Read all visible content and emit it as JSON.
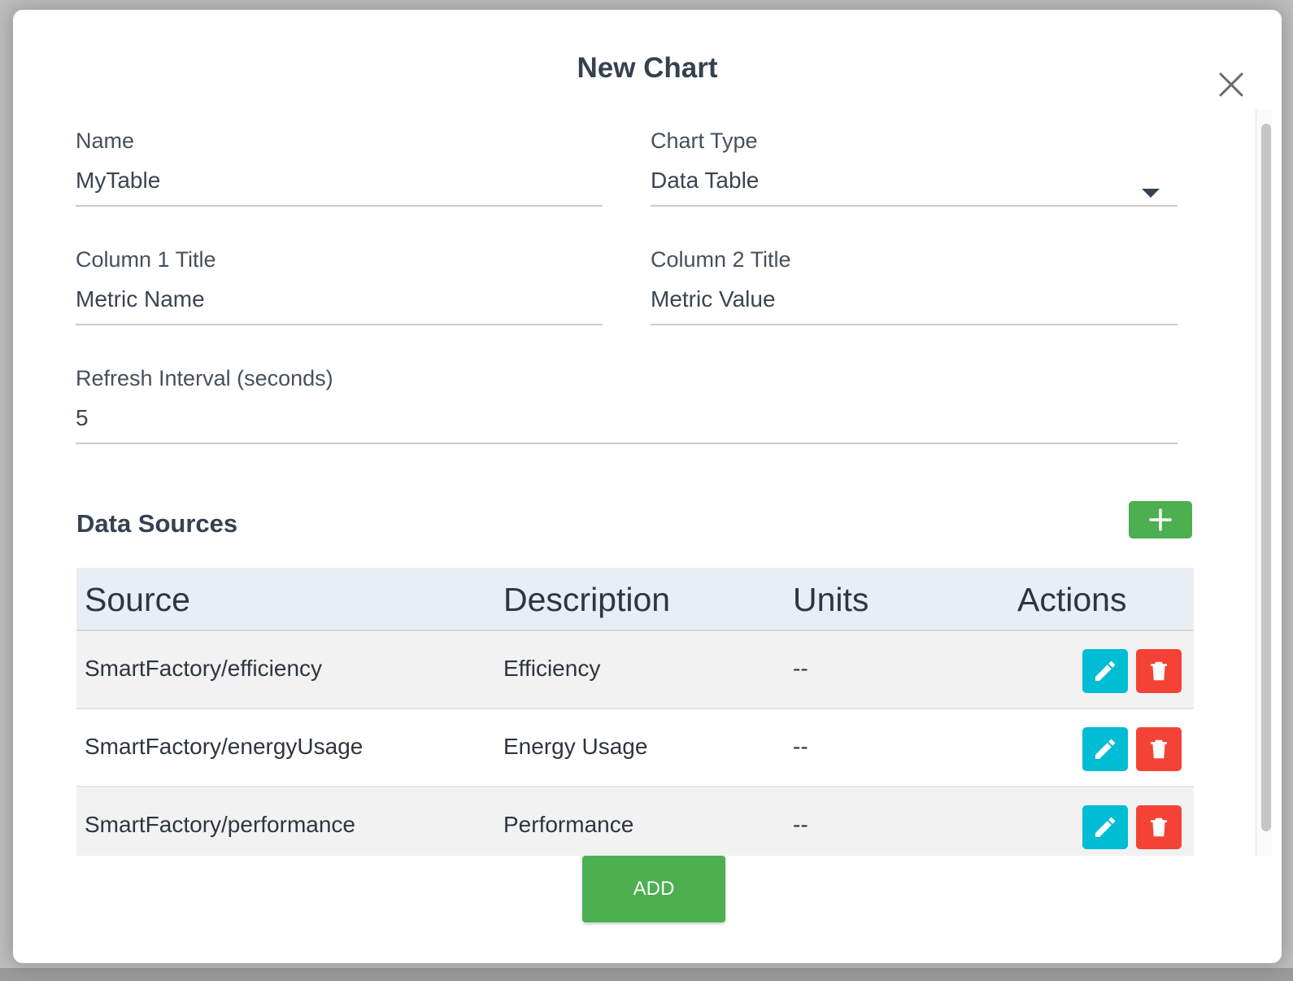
{
  "dialog": {
    "title": "New Chart",
    "close_icon": "close-icon"
  },
  "form": {
    "name": {
      "label": "Name",
      "value": "MyTable"
    },
    "chart_type": {
      "label": "Chart Type",
      "value": "Data Table"
    },
    "column1": {
      "label": "Column 1 Title",
      "value": "Metric Name"
    },
    "column2": {
      "label": "Column 2 Title",
      "value": "Metric Value"
    },
    "refresh": {
      "label": "Refresh Interval (seconds)",
      "value": "5"
    }
  },
  "data_sources": {
    "title": "Data Sources",
    "add_icon": "plus-icon",
    "columns": [
      "Source",
      "Description",
      "Units",
      "Actions"
    ],
    "rows": [
      {
        "source": "SmartFactory/efficiency",
        "description": "Efficiency",
        "units": "--"
      },
      {
        "source": "SmartFactory/energyUsage",
        "description": "Energy Usage",
        "units": "--"
      },
      {
        "source": "SmartFactory/performance",
        "description": "Performance",
        "units": "--"
      }
    ],
    "edit_icon": "pencil-icon",
    "delete_icon": "trash-icon"
  },
  "footer": {
    "submit_label": "ADD"
  },
  "colors": {
    "primary_green": "#4caf50",
    "edit_cyan": "#00bcd4",
    "delete_red": "#f44336"
  }
}
